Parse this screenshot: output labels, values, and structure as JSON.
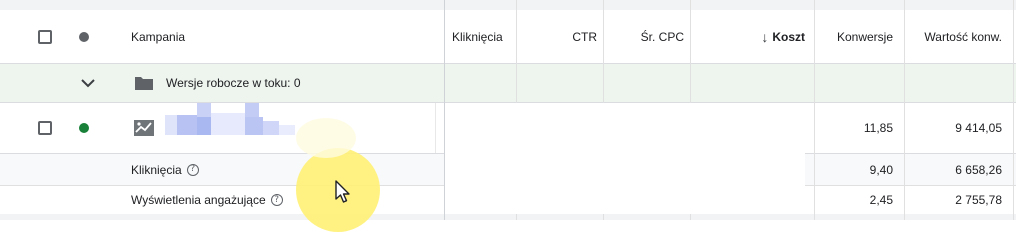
{
  "header": {
    "campaign": "Kampania",
    "clicks": "Kliknięcia",
    "ctr": "CTR",
    "avg_cpc": "Śr. CPC",
    "cost": "Koszt",
    "cost_sort_arrow": "↓",
    "conversions": "Konwersje",
    "conv_value": "Wartość konw."
  },
  "draft_row": {
    "label": "Wersje robocze w toku: 0"
  },
  "campaign_row": {
    "conversions": "11,85",
    "conv_value": "9 414,05"
  },
  "breakdown_rows": [
    {
      "label": "Kliknięcia",
      "help": "?",
      "conversions": "9,40",
      "conv_value": "6 658,26"
    },
    {
      "label": "Wyświetlenia angażujące",
      "help": "?",
      "conversions": "2,45",
      "conv_value": "2 755,78"
    }
  ],
  "colors": {
    "header_dot": "#5f6368",
    "enabled_dot": "#188038",
    "draft_row_bg": "#eef4ee",
    "breakdown_bg": "#f8f9fa",
    "cursor_highlight": "#fff176"
  }
}
